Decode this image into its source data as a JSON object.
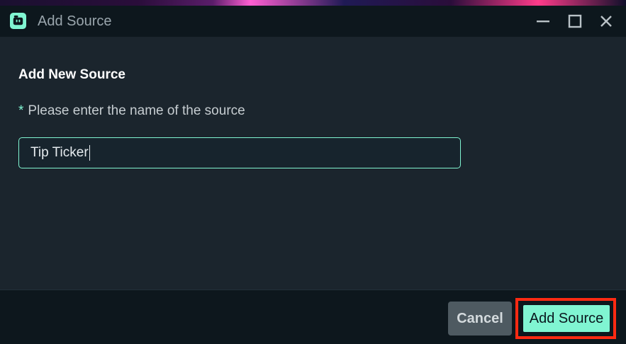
{
  "window": {
    "title": "Add Source",
    "logo_icon": "streamlabs-logo-icon",
    "minimize_icon": "minimize-icon",
    "maximize_icon": "maximize-icon",
    "close_icon": "close-icon"
  },
  "dialog": {
    "heading": "Add New Source",
    "required_marker": "*",
    "field_label": "Please enter the name of the source",
    "input_value": "Tip Ticker"
  },
  "footer": {
    "cancel_label": "Cancel",
    "add_label": "Add Source"
  },
  "colors": {
    "accent": "#80f5d2",
    "highlight_border": "#ff2a12",
    "titlebar_bg": "#0d171d",
    "body_bg": "#1b252d",
    "cancel_bg": "#4e5a61"
  }
}
